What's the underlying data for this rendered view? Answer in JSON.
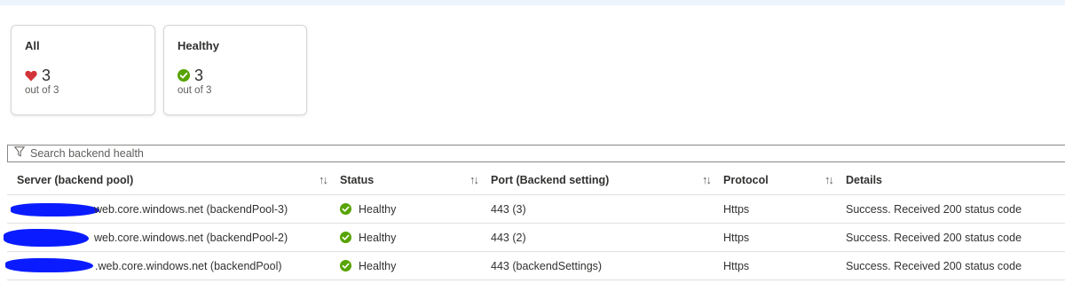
{
  "cards": [
    {
      "title": "All",
      "count": "3",
      "sub": "out of 3",
      "icon": "heart-icon",
      "icon_color": "#d13438"
    },
    {
      "title": "Healthy",
      "count": "3",
      "sub": "out of 3",
      "icon": "check-circle-icon",
      "icon_color": "#57a300"
    }
  ],
  "search": {
    "placeholder": "Search backend health"
  },
  "table": {
    "columns": [
      "Server (backend pool)",
      "Status",
      "Port (Backend setting)",
      "Protocol",
      "Details"
    ],
    "rows": [
      {
        "server": "web.core.windows.net (backendPool-3)",
        "status": "Healthy",
        "port": "443 (3)",
        "protocol": "Https",
        "details": "Success. Received 200 status code"
      },
      {
        "server": "web.core.windows.net (backendPool-2)",
        "status": "Healthy",
        "port": "443 (2)",
        "protocol": "Https",
        "details": "Success. Received 200 status code"
      },
      {
        "server": ".web.core.windows.net (backendPool)",
        "status": "Healthy",
        "port": "443 (backendSettings)",
        "protocol": "Https",
        "details": "Success. Received 200 status code"
      }
    ]
  },
  "colors": {
    "healthy": "#57a300",
    "unhealthy_heart": "#d13438",
    "redaction": "#0a1cff"
  }
}
